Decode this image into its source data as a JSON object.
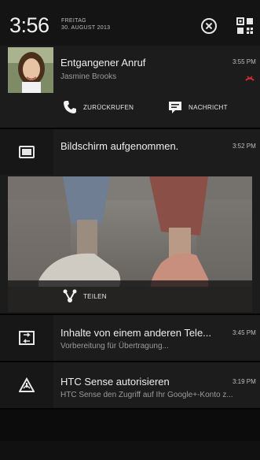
{
  "status_bar": {
    "time": "3:56",
    "weekday": "FREITAG",
    "date": "30. AUGUST 2013"
  },
  "notifications": [
    {
      "title": "Entgangener Anruf",
      "subtitle": "Jasmine Brooks",
      "time": "3:55 PM",
      "actions": [
        "ZURÜCKRUFEN",
        "NACHRICHT"
      ]
    },
    {
      "title": "Bildschirm aufgenommen.",
      "time": "3:52 PM",
      "actions": [
        "TEILEN"
      ]
    },
    {
      "title": "Inhalte von einem anderen Tele...",
      "subtitle": "Vorbereitung für Übertragung...",
      "time": "3:45 PM"
    },
    {
      "title": "HTC Sense autorisieren",
      "subtitle": "HTC Sense den Zugriff auf Ihr Google+-Konto z...",
      "time": "3:19 PM"
    }
  ]
}
